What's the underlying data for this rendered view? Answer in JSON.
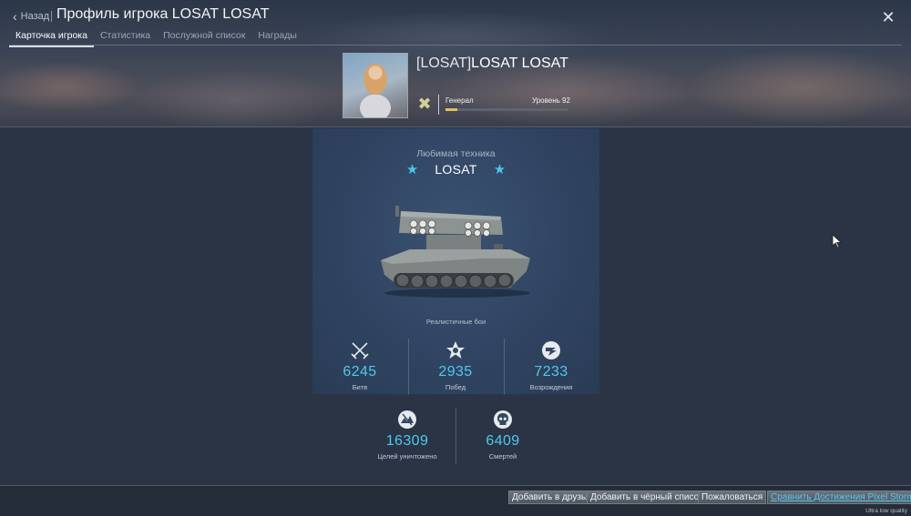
{
  "header": {
    "back_label": "Назад",
    "title": "Профиль игрока LOSAT LOSAT",
    "close_icon": "close-icon",
    "tabs": [
      {
        "label": "Карточка игрока",
        "active": true
      },
      {
        "label": "Статистика",
        "active": false
      },
      {
        "label": "Послужной список",
        "active": false
      },
      {
        "label": "Награды",
        "active": false
      }
    ]
  },
  "player": {
    "clan_tag": "[LOSAT]",
    "name": "LOSAT LOSAT",
    "rank": "Генерал",
    "level_label": "Уровень 92",
    "level_progress": 0.1,
    "progress_color": "#e3c060"
  },
  "favorite": {
    "label": "Любимая техника",
    "vehicle": "LOSAT",
    "mode": "Реалистичные бои",
    "star_color": "#4fc3ea"
  },
  "stats": [
    {
      "icon": "crossed-swords-icon",
      "value": "6245",
      "label": "Битв"
    },
    {
      "icon": "victory-star-icon",
      "value": "2935",
      "label": "Побед"
    },
    {
      "icon": "respawn-icon",
      "value": "7233",
      "label": "Возрождения"
    },
    {
      "icon": "target-destroyed-icon",
      "value": "16309",
      "label": "Целей уничтожено"
    },
    {
      "icon": "skull-icon",
      "value": "6409",
      "label": "Смертей"
    }
  ],
  "footer": {
    "buttons": [
      {
        "label": "Добавить в друзья"
      },
      {
        "label": "Добавить в чёрный список"
      },
      {
        "label": "Пожаловаться"
      },
      {
        "label": "Сравнить Достижения Pixel Storm"
      }
    ],
    "quality_label": "Ultra low quality"
  },
  "accent_color": "#4fc8f0"
}
